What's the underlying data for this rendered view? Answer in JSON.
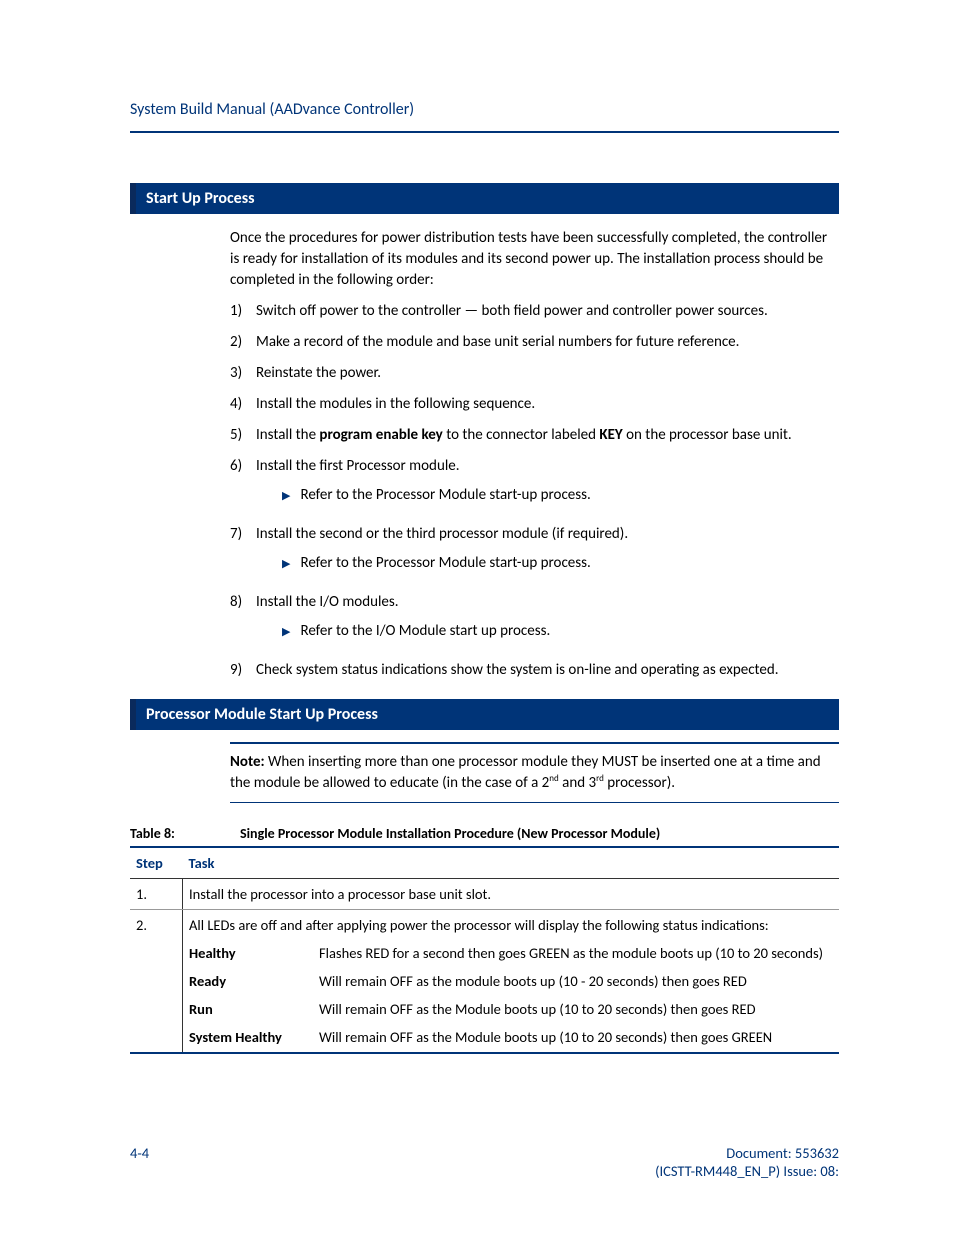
{
  "header": {
    "title": "System Build Manual  (AADvance Controller)"
  },
  "section1": {
    "title": "Start Up Process"
  },
  "intro": "Once the procedures for power distribution tests have been successfully completed, the controller is ready for installation of its modules and its second power up. The installation process should be completed in the following order:",
  "steps": [
    {
      "n": "1)",
      "text": "Switch off power to the controller — both field power and controller power sources."
    },
    {
      "n": "2)",
      "text": "Make a record of the module and base unit serial numbers for future reference."
    },
    {
      "n": "3)",
      "text": "Reinstate the power."
    },
    {
      "n": "4)",
      "text": "Install the modules in the following sequence."
    },
    {
      "n": "5)",
      "pre": "Install the ",
      "b1": "program enable key",
      "mid": " to the connector labeled ",
      "b2": "KEY",
      "post": " on the processor base unit."
    },
    {
      "n": "6)",
      "text": "Install the first Processor module.",
      "sub": "Refer to the Processor Module start-up process."
    },
    {
      "n": "7)",
      "text": "Install the second or the third processor module (if required).",
      "sub": "Refer to the Processor Module start-up process."
    },
    {
      "n": "8)",
      "text": "Install the I/O modules.",
      "sub": "Refer to the I/O Module start up process."
    },
    {
      "n": "9)",
      "text": "Check system status indications show the system is on-line and operating as expected."
    }
  ],
  "section2": {
    "title": "Processor Module Start Up Process"
  },
  "note": {
    "label": "Note:",
    "pre": " When inserting more than one processor module they MUST be inserted one at a time and the module be allowed to educate (in the case of a 2",
    "sup1": "nd",
    "mid": " and 3",
    "sup2": "rd",
    "post": " processor)."
  },
  "table": {
    "label": "Table 8:",
    "caption": "Single Processor Module Installation Procedure (New Processor Module)",
    "head": {
      "c1": "Step",
      "c2": "Task"
    },
    "row1": {
      "step": "1.",
      "task": "Install the processor into a processor base unit slot."
    },
    "row2": {
      "step": "2.",
      "intro": "All LEDs are off and after applying power the processor will display the following status indications:",
      "items": [
        {
          "label": "Healthy",
          "desc": "Flashes RED for a second then goes GREEN as the module boots up (10 to 20 seconds)"
        },
        {
          "label": "Ready",
          "desc": "Will remain OFF as the module boots up (10 - 20 seconds) then goes RED"
        },
        {
          "label": "Run",
          "desc": "Will remain OFF as the Module boots up (10 to 20 seconds) then goes RED"
        },
        {
          "label": "System Healthy",
          "desc": "Will remain OFF as the Module boots up (10 to 20 seconds) then goes GREEN"
        }
      ]
    }
  },
  "footer": {
    "left": "4-4",
    "right1": "Document: 553632",
    "right2": "(ICSTT-RM448_EN_P) Issue: 08:"
  }
}
